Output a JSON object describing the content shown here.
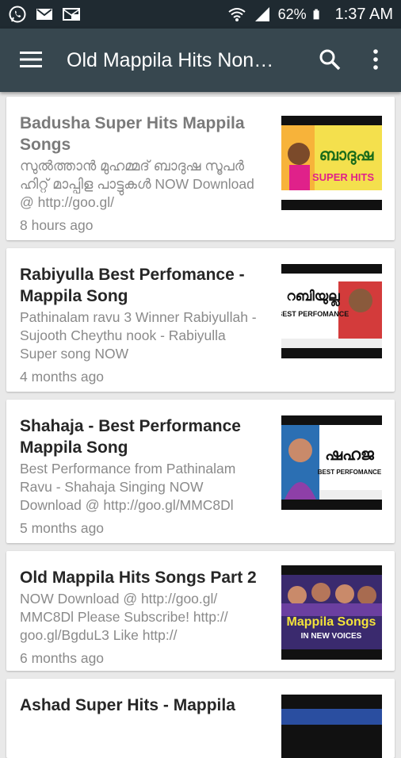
{
  "status_bar": {
    "battery": "62%",
    "time": "1:37 AM"
  },
  "toolbar": {
    "title": "Old Mappila Hits Non…"
  },
  "videos": [
    {
      "title": "Badusha Super Hits Mappila Songs",
      "description": "സുൽത്താൻ മുഹമ്മദ് ബാദുഷ സൂപർ ഹിറ്റ് മാപ്പിള പാട്ടുകൾ NOW Download @ http://goo.gl/",
      "time": "8 hours ago",
      "thumb_text": "ബാദുഷ",
      "thumb_caption": "SUPER HITS",
      "colors": [
        "#f4e04d",
        "#e0218a"
      ]
    },
    {
      "title": "Rabiyulla Best Perfomance - Mappila Song",
      "description": "Pathinalam ravu 3 Winner Rabiyullah - Sujooth Cheythu nook - Rabiyulla Super song NOW",
      "time": "4 months ago",
      "thumb_text": "റബിയുല്ല",
      "thumb_caption": "BEST PERFOMANCE",
      "colors": [
        "#ffffff",
        "#d33b3b"
      ]
    },
    {
      "title": "Shahaja - Best Performance Mappila Song",
      "description": "Best Performance from Pathinalam Ravu - Shahaja Singing NOW Download @ http://goo.gl/MMC8Dl",
      "time": "5 months ago",
      "thumb_text": "ഷഹജ",
      "thumb_caption": "BEST PERFOMANCE",
      "colors": [
        "#ffffff",
        "#2b6fb3"
      ]
    },
    {
      "title": "Old Mappila Hits Songs Part 2",
      "description": "NOW Download @ http://goo.gl/ MMC8Dl Please Subscribe! http:// goo.gl/BgduL3 Like http://",
      "time": "6 months ago",
      "thumb_text": "Mappila Songs",
      "thumb_caption": "IN NEW VOICES",
      "colors": [
        "#3a2a6e",
        "#f3e33a"
      ]
    },
    {
      "title": "Ashad Super Hits - Mappila",
      "description": "",
      "time": "",
      "thumb_text": "",
      "thumb_caption": "",
      "colors": [
        "#2a4ea0",
        "#111111"
      ]
    }
  ]
}
